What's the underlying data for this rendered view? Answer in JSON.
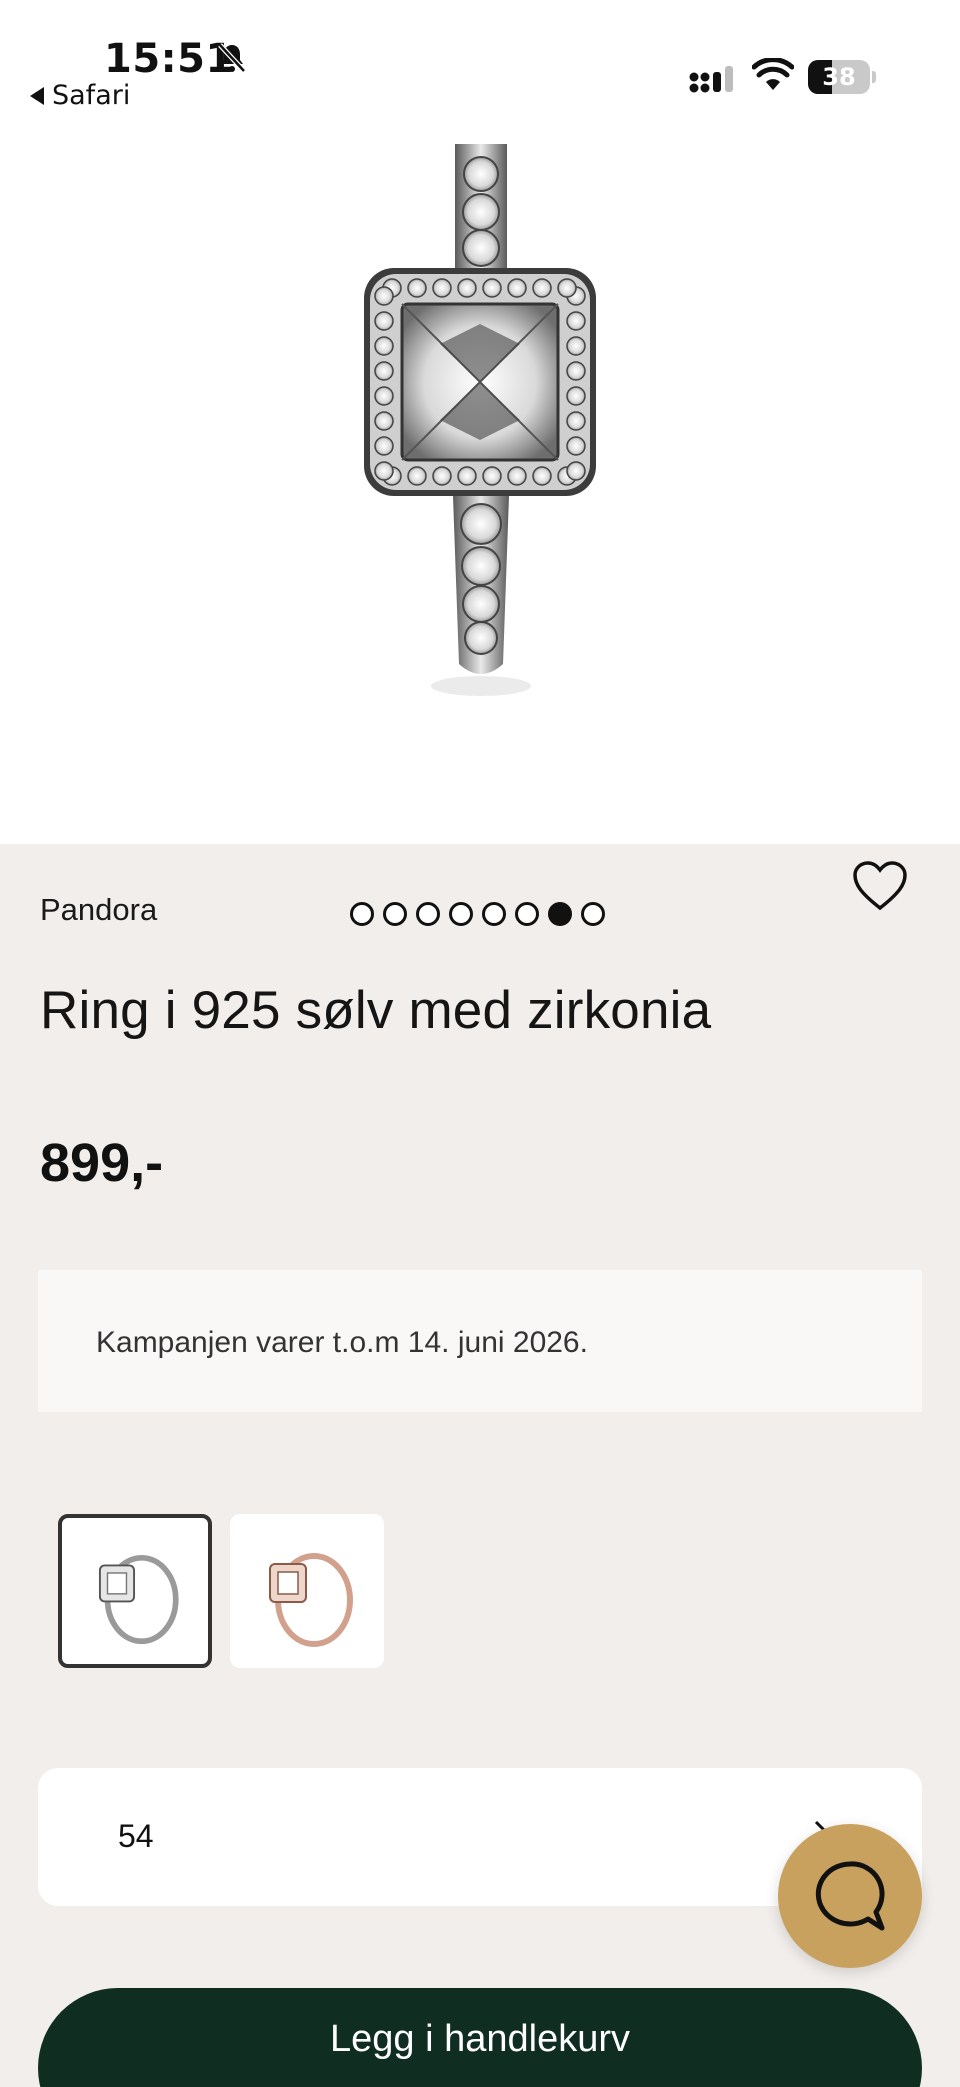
{
  "status_bar": {
    "time": "15:51",
    "back_label": "Safari",
    "battery": "38",
    "battery_level": 0.38,
    "icons": [
      "bell-slash-icon",
      "signal-icon",
      "wifi-icon",
      "battery-icon"
    ]
  },
  "gallery": {
    "image_count": 8,
    "active_index": 6,
    "favorite_icon": "heart-icon"
  },
  "product": {
    "brand": "Pandora",
    "title": "Ring i 925 sølv med zirkonia",
    "price": "899,-",
    "campaign": "Kampanjen varer t.o.m 14. juni 2026."
  },
  "variants": [
    {
      "name": "silver",
      "selected": true
    },
    {
      "name": "rose-gold",
      "selected": false
    }
  ],
  "size": {
    "value": "54"
  },
  "chat": {
    "icon": "chat-bubble-icon"
  },
  "cart": {
    "label": "Legg i handlekurv"
  },
  "colors": {
    "page_bg": "#f1eeeb",
    "cart_button": "#0f2d21",
    "chat_button": "#c8a15e"
  }
}
